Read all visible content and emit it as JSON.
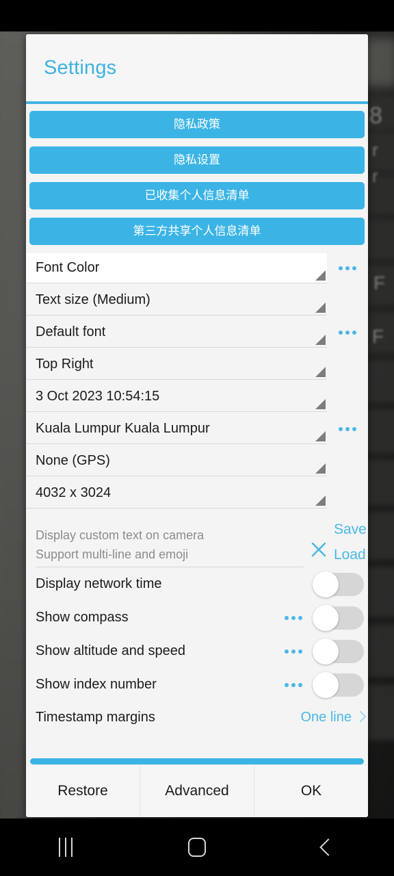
{
  "dialog": {
    "title": "Settings",
    "blue_buttons": [
      {
        "name": "privacy-policy",
        "label": "隐私政策"
      },
      {
        "name": "privacy-settings",
        "label": "隐私设置"
      },
      {
        "name": "collected-personal-info-list",
        "label": "已收集个人信息清单"
      },
      {
        "name": "third-party-shared-info-list",
        "label": "第三方共享个人信息清单"
      }
    ],
    "spinners": [
      {
        "name": "font-color",
        "value": "Font Color",
        "has_more": true,
        "highlight": true
      },
      {
        "name": "text-size",
        "value": "Text size (Medium)",
        "has_more": false,
        "highlight": false
      },
      {
        "name": "font-family",
        "value": "Default font",
        "has_more": true,
        "highlight": false
      },
      {
        "name": "position",
        "value": "Top Right",
        "has_more": false,
        "highlight": false
      },
      {
        "name": "datetime",
        "value": "3 Oct 2023 10:54:15",
        "has_more": false,
        "highlight": false
      },
      {
        "name": "location",
        "value": "Kuala Lumpur Kuala Lumpur",
        "has_more": true,
        "highlight": false
      },
      {
        "name": "coordinates",
        "value": "None (GPS)",
        "has_more": false,
        "highlight": false
      },
      {
        "name": "resolution",
        "value": "4032 x 3024",
        "has_more": false,
        "highlight": false
      }
    ],
    "custom_text": {
      "value": "",
      "placeholder_line1": "Display custom text on camera",
      "placeholder_line2": "Support multi-line and emoji",
      "clear_label": "×",
      "save_label": "Save",
      "load_label": "Load"
    },
    "switches": [
      {
        "name": "display-network-time",
        "label": "Display network time",
        "has_more": false,
        "on": false
      },
      {
        "name": "show-compass",
        "label": "Show compass",
        "has_more": true,
        "on": false
      },
      {
        "name": "show-altitude-and-speed",
        "label": "Show altitude and speed",
        "has_more": true,
        "on": false
      },
      {
        "name": "show-index-number",
        "label": "Show index number",
        "has_more": true,
        "on": false
      }
    ],
    "chevron_row": {
      "name": "timestamp-margins",
      "label": "Timestamp margins",
      "value": "One line"
    },
    "footer": {
      "restore_label": "Restore",
      "advanced_label": "Advanced",
      "ok_label": "OK"
    }
  },
  "navbar": {
    "recents_label": "recents-icon",
    "home_label": "home-icon",
    "back_label": "back-icon"
  },
  "colors": {
    "accent": "#3bb4e5",
    "accent_text": "#4bb8e4",
    "dialog_bg": "#f4f4f4",
    "text": "#1b1b1b",
    "placeholder": "#8c8c8c"
  }
}
